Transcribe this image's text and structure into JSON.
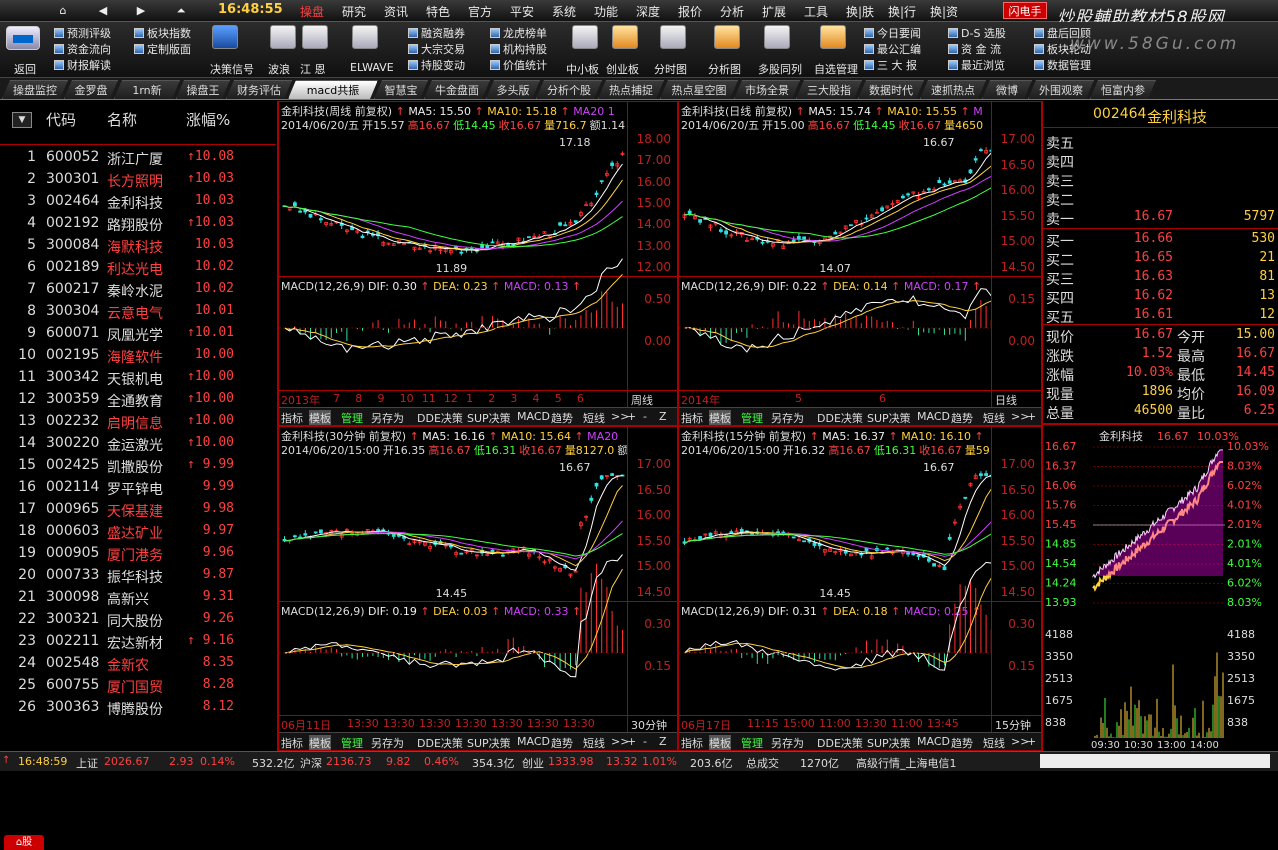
{
  "topbar": {
    "clock": "16:48:55",
    "menus": [
      "操盘",
      "研究",
      "资讯",
      "特色",
      "官方",
      "平安",
      "系统",
      "功能",
      "深度",
      "报价",
      "分析",
      "扩展",
      "工具",
      "换|肤",
      "换|行",
      "换|资"
    ],
    "flash": "闪电手",
    "brand": "炒股輔助教材58股网",
    "url": "www.58Gu.com"
  },
  "toolbar": {
    "left": [
      "返回"
    ],
    "col1": [
      "预测评级",
      "资金流向",
      "财报解读"
    ],
    "col2": [
      "板块指数",
      "定制版面"
    ],
    "bigicons": [
      "决策信号",
      "波浪",
      "江 恩",
      "ELWAVE"
    ],
    "col3": [
      "融资融券",
      "大宗交易",
      "持股变动"
    ],
    "col4": [
      "龙虎榜单",
      "机构持股",
      "价值统计"
    ],
    "bigicons2": [
      "中小板",
      "创业板",
      "分时图",
      "分析图",
      "多股同列",
      "自选管理"
    ],
    "col5": [
      "今日要闻",
      "最公汇编",
      "三 大 报"
    ],
    "col6": [
      "D-S 选股",
      "资 金 流",
      "最近浏览"
    ],
    "col7": [
      "盘后回顾",
      "板块轮动",
      "数据管理"
    ]
  },
  "tabs": [
    "操盘监控",
    "金罗盘",
    "1rn新",
    "操盘王",
    "财务评估",
    "macd共振",
    "智慧宝",
    "牛金盘面",
    "多头版",
    "分析个股",
    "热点捕捉",
    "热点星空图",
    "市场全景",
    "三大股指",
    "数据时代",
    "速抓热点",
    "微博",
    "外围观察",
    "恒富内参"
  ],
  "list": {
    "headers": {
      "code": "代码",
      "name": "名称",
      "pct": "涨幅%"
    },
    "rows": [
      {
        "n": "1",
        "code": "600052",
        "name": "浙江广厦",
        "pct": "↑10.08",
        "color": "#ddd"
      },
      {
        "n": "2",
        "code": "300301",
        "name": "长方照明",
        "pct": "↑10.03",
        "color": "#ff4040"
      },
      {
        "n": "3",
        "code": "002464",
        "name": "金利科技",
        "pct": "10.03",
        "color": "#ddd"
      },
      {
        "n": "4",
        "code": "002192",
        "name": "路翔股份",
        "pct": "↑10.03",
        "color": "#ddd"
      },
      {
        "n": "5",
        "code": "300084",
        "name": "海默科技",
        "pct": "10.03",
        "color": "#ff4040"
      },
      {
        "n": "6",
        "code": "002189",
        "name": "利达光电",
        "pct": "10.02",
        "color": "#ff4040"
      },
      {
        "n": "7",
        "code": "600217",
        "name": "秦岭水泥",
        "pct": "10.02",
        "color": "#ddd"
      },
      {
        "n": "8",
        "code": "300304",
        "name": "云意电气",
        "pct": "10.01",
        "color": "#ff4040"
      },
      {
        "n": "9",
        "code": "600071",
        "name": "凤凰光学",
        "pct": "↑10.01",
        "color": "#ddd"
      },
      {
        "n": "10",
        "code": "002195",
        "name": "海隆软件",
        "pct": "10.00",
        "color": "#ff4040"
      },
      {
        "n": "11",
        "code": "300342",
        "name": "天银机电",
        "pct": "↑10.00",
        "color": "#ddd"
      },
      {
        "n": "12",
        "code": "300359",
        "name": "全通教育",
        "pct": "↑10.00",
        "color": "#ddd"
      },
      {
        "n": "13",
        "code": "002232",
        "name": "启明信息",
        "pct": "↑10.00",
        "color": "#ff4040"
      },
      {
        "n": "14",
        "code": "300220",
        "name": "金运激光",
        "pct": "↑10.00",
        "color": "#ddd"
      },
      {
        "n": "15",
        "code": "002425",
        "name": "凯撒股份",
        "pct": "↑ 9.99",
        "color": "#ddd"
      },
      {
        "n": "16",
        "code": "002114",
        "name": "罗平锌电",
        "pct": "9.99",
        "color": "#ddd"
      },
      {
        "n": "17",
        "code": "000965",
        "name": "天保基建",
        "pct": "9.98",
        "color": "#ff4040"
      },
      {
        "n": "18",
        "code": "000603",
        "name": "盛达矿业",
        "pct": "9.97",
        "color": "#ff4040"
      },
      {
        "n": "19",
        "code": "000905",
        "name": "厦门港务",
        "pct": "9.96",
        "color": "#ff4040"
      },
      {
        "n": "20",
        "code": "000733",
        "name": "振华科技",
        "pct": "9.87",
        "color": "#ddd"
      },
      {
        "n": "21",
        "code": "300098",
        "name": "高新兴",
        "pct": "9.31",
        "color": "#ddd"
      },
      {
        "n": "22",
        "code": "300321",
        "name": "同大股份",
        "pct": "9.26",
        "color": "#ddd"
      },
      {
        "n": "23",
        "code": "002211",
        "name": "宏达新材",
        "pct": "↑ 9.16",
        "color": "#ddd"
      },
      {
        "n": "24",
        "code": "002548",
        "name": "金新农",
        "pct": "8.35",
        "color": "#ff4040"
      },
      {
        "n": "25",
        "code": "600755",
        "name": "厦门国贸",
        "pct": "8.28",
        "color": "#ff4040"
      },
      {
        "n": "26",
        "code": "300363",
        "name": "博腾股份",
        "pct": "8.12",
        "color": "#ddd"
      }
    ],
    "home": "股"
  },
  "charts": [
    {
      "title": "金利科技(周线 前复权)",
      "ma5": "MA5: 15.50",
      "ma10": "MA10: 15.18",
      "ma20": "MA20 1",
      "info_date": "2014/06/20/五",
      "info_open": "开15.57",
      "info_high": "高16.67",
      "info_low": "低14.45",
      "info_close": "收16.67",
      "info_vol": "量716.7",
      "info_amt": "额1.14",
      "axis": [
        "18.00",
        "17.00",
        "16.00",
        "15.00",
        "14.00",
        "13.00",
        "12.00"
      ],
      "hi": "17.18",
      "lo": "11.89",
      "macd_label": "MACD(12,26,9)",
      "dif": "DIF: 0.30",
      "dea": "DEA: 0.23",
      "macd": "MACD: 0.13",
      "macd_axis": [
        "0.50",
        "0.00"
      ],
      "dates": [
        "2013年",
        "7",
        "8",
        "9",
        "10",
        "11",
        "12",
        "1",
        "2",
        "3",
        "4",
        "5",
        "6"
      ],
      "period": "周线"
    },
    {
      "title": "金利科技(日线 前复权)",
      "ma5": "MA5: 15.74",
      "ma10": "MA10: 15.55",
      "ma20": "M",
      "info_date": "2014/06/20/五",
      "info_open": "开15.00",
      "info_high": "高16.67",
      "info_low": "低14.45",
      "info_close": "收16.67",
      "info_vol": "量4650",
      "info_amt": "",
      "axis": [
        "17.00",
        "16.50",
        "16.00",
        "15.50",
        "15.00",
        "14.50"
      ],
      "hi": "16.67",
      "lo": "14.07",
      "macd_label": "MACD(12,26,9)",
      "dif": "DIF: 0.22",
      "dea": "DEA: 0.14",
      "macd": "MACD: 0.17",
      "macd_axis": [
        "0.15",
        "0.00"
      ],
      "dates": [
        "2014年",
        "5",
        "6"
      ],
      "period": "日线"
    },
    {
      "title": "金利科技(30分钟 前复权)",
      "ma5": "MA5: 16.16",
      "ma10": "MA10: 15.64",
      "ma20": "MA20",
      "info_date": "2014/06/20/15:00",
      "info_open": "开16.35",
      "info_high": "高16.67",
      "info_low": "低16.31",
      "info_close": "收16.67",
      "info_vol": "量8127.0",
      "info_amt": "额",
      "axis": [
        "17.00",
        "16.50",
        "16.00",
        "15.50",
        "15.00",
        "14.50"
      ],
      "hi": "16.67",
      "lo": "14.45",
      "macd_label": "MACD(12,26,9)",
      "dif": "DIF: 0.19",
      "dea": "DEA: 0.03",
      "macd": "MACD: 0.33",
      "macd_axis": [
        "0.30",
        "0.15"
      ],
      "dates": [
        "06月11日",
        "13:30",
        "13:30",
        "13:30",
        "13:30",
        "13:30",
        "13:30",
        "13:30"
      ],
      "period": "30分钟"
    },
    {
      "title": "金利科技(15分钟 前复权)",
      "ma5": "MA5: 16.37",
      "ma10": "MA10: 16.10",
      "ma20": "",
      "info_date": "2014/06/20/15:00",
      "info_open": "开16.32",
      "info_high": "高16.67",
      "info_low": "低16.31",
      "info_close": "收16.67",
      "info_vol": "量59",
      "info_amt": "",
      "axis": [
        "17.00",
        "16.50",
        "16.00",
        "15.50",
        "15.00",
        "14.50"
      ],
      "hi": "16.67",
      "lo": "14.45",
      "macd_label": "MACD(12,26,9)",
      "dif": "DIF: 0.31",
      "dea": "DEA: 0.18",
      "macd": "MACD: 0.25",
      "macd_axis": [
        "0.30",
        "0.15"
      ],
      "dates": [
        "06月17日",
        "11:15",
        "15:00",
        "11:00",
        "13:30",
        "11:00",
        "13:45"
      ],
      "period": "15分钟"
    }
  ],
  "btnrow": [
    "指标",
    "模板",
    "管理",
    "另存为",
    "DDE决策",
    "SUP决策",
    "MACD",
    "趋势",
    "短线",
    ">>",
    "+",
    "-",
    "Z"
  ],
  "quote": {
    "code": "002464",
    "name": "金利科技",
    "asks": [
      {
        "l": "卖五",
        "p": "",
        "v": ""
      },
      {
        "l": "卖四",
        "p": "",
        "v": ""
      },
      {
        "l": "卖三",
        "p": "",
        "v": ""
      },
      {
        "l": "卖二",
        "p": "",
        "v": ""
      },
      {
        "l": "卖一",
        "p": "16.67",
        "v": "5797"
      }
    ],
    "bids": [
      {
        "l": "买一",
        "p": "16.66",
        "v": "530"
      },
      {
        "l": "买二",
        "p": "16.65",
        "v": "21"
      },
      {
        "l": "买三",
        "p": "16.63",
        "v": "81"
      },
      {
        "l": "买四",
        "p": "16.62",
        "v": "13"
      },
      {
        "l": "买五",
        "p": "16.61",
        "v": "12"
      }
    ],
    "stats": [
      {
        "l": "现价",
        "v": "16.67",
        "l2": "今开",
        "v2": "15.00"
      },
      {
        "l": "涨跌",
        "v": "1.52",
        "l2": "最高",
        "v2": "16.67"
      },
      {
        "l": "涨幅",
        "v": "10.03%",
        "l2": "最低",
        "v2": "14.45"
      },
      {
        "l": "现量",
        "v": "1896",
        "l2": "均价",
        "v2": "16.09"
      },
      {
        "l": "总量",
        "v": "46500",
        "l2": "量比",
        "v2": "6.25"
      }
    ],
    "mini_title": "金利科技",
    "mini_price": "16.67",
    "mini_pct": "10.03%",
    "mini_left": [
      "16.67",
      "16.37",
      "16.06",
      "15.76",
      "15.45",
      "14.85",
      "14.54",
      "14.24",
      "13.93"
    ],
    "mini_right": [
      "10.03%",
      "8.03%",
      "6.02%",
      "4.01%",
      "2.01%",
      "2.01%",
      "4.01%",
      "6.02%",
      "8.03%"
    ],
    "vol_axis": [
      "4188",
      "3350",
      "2513",
      "1675",
      "838"
    ],
    "vol_left": [
      "4188",
      "3350",
      "2513",
      "1675",
      "838"
    ],
    "times": [
      "09:30",
      "10:30",
      "13:00",
      "14:00"
    ]
  },
  "status": {
    "time": "16:48:59",
    "sh_label": "上证",
    "sh": "2026.67",
    "sh_ch": "2.93",
    "sh_pct": "0.14%",
    "sh_amt": "532.2亿",
    "sz_label": "沪深",
    "sz": "2136.73",
    "sz_ch": "9.82",
    "sz_pct": "0.46%",
    "sz_amt": "354.3亿",
    "cy_label": "创业",
    "cy": "1333.98",
    "cy_ch": "13.32",
    "cy_pct": "1.01%",
    "cy_amt": "203.6亿",
    "deal": "总成交",
    "deal_amt": "1270亿",
    "feed": "高级行情_上海电信1"
  }
}
